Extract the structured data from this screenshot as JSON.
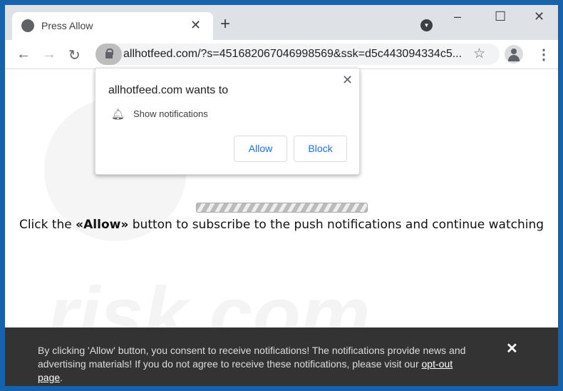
{
  "tab": {
    "title": "Press Allow",
    "close": "✕",
    "new_tab": "+"
  },
  "window_controls": {
    "minimize": "–",
    "maximize": "☐",
    "close": "✕"
  },
  "toolbar": {
    "back": "←",
    "forward": "→",
    "reload": "↻",
    "url": "allhotfeed.com/?s=451682067046998569&ssk=d5c443094334c5...",
    "star": "☆",
    "menu": "⋮"
  },
  "popup": {
    "heading": "allhotfeed.com wants to",
    "permission": "Show notifications",
    "allow": "Allow",
    "block": "Block",
    "close": "✕"
  },
  "page": {
    "message_pre": "Click the ",
    "message_bold": "«Allow»",
    "message_post": " button to subscribe to the push notifications and continue watching",
    "watermark": "risk.com"
  },
  "banner": {
    "text": "By clicking 'Allow' button, you consent to receive notifications! The notifications provide news and advertising materials! If you do not agree to receive these notifications, please visit our ",
    "link": "opt-out page",
    "end": ".",
    "close": "✕"
  },
  "colors": {
    "frame": "#1662ad",
    "accent": "#1a73e8",
    "banner": "#333333"
  }
}
